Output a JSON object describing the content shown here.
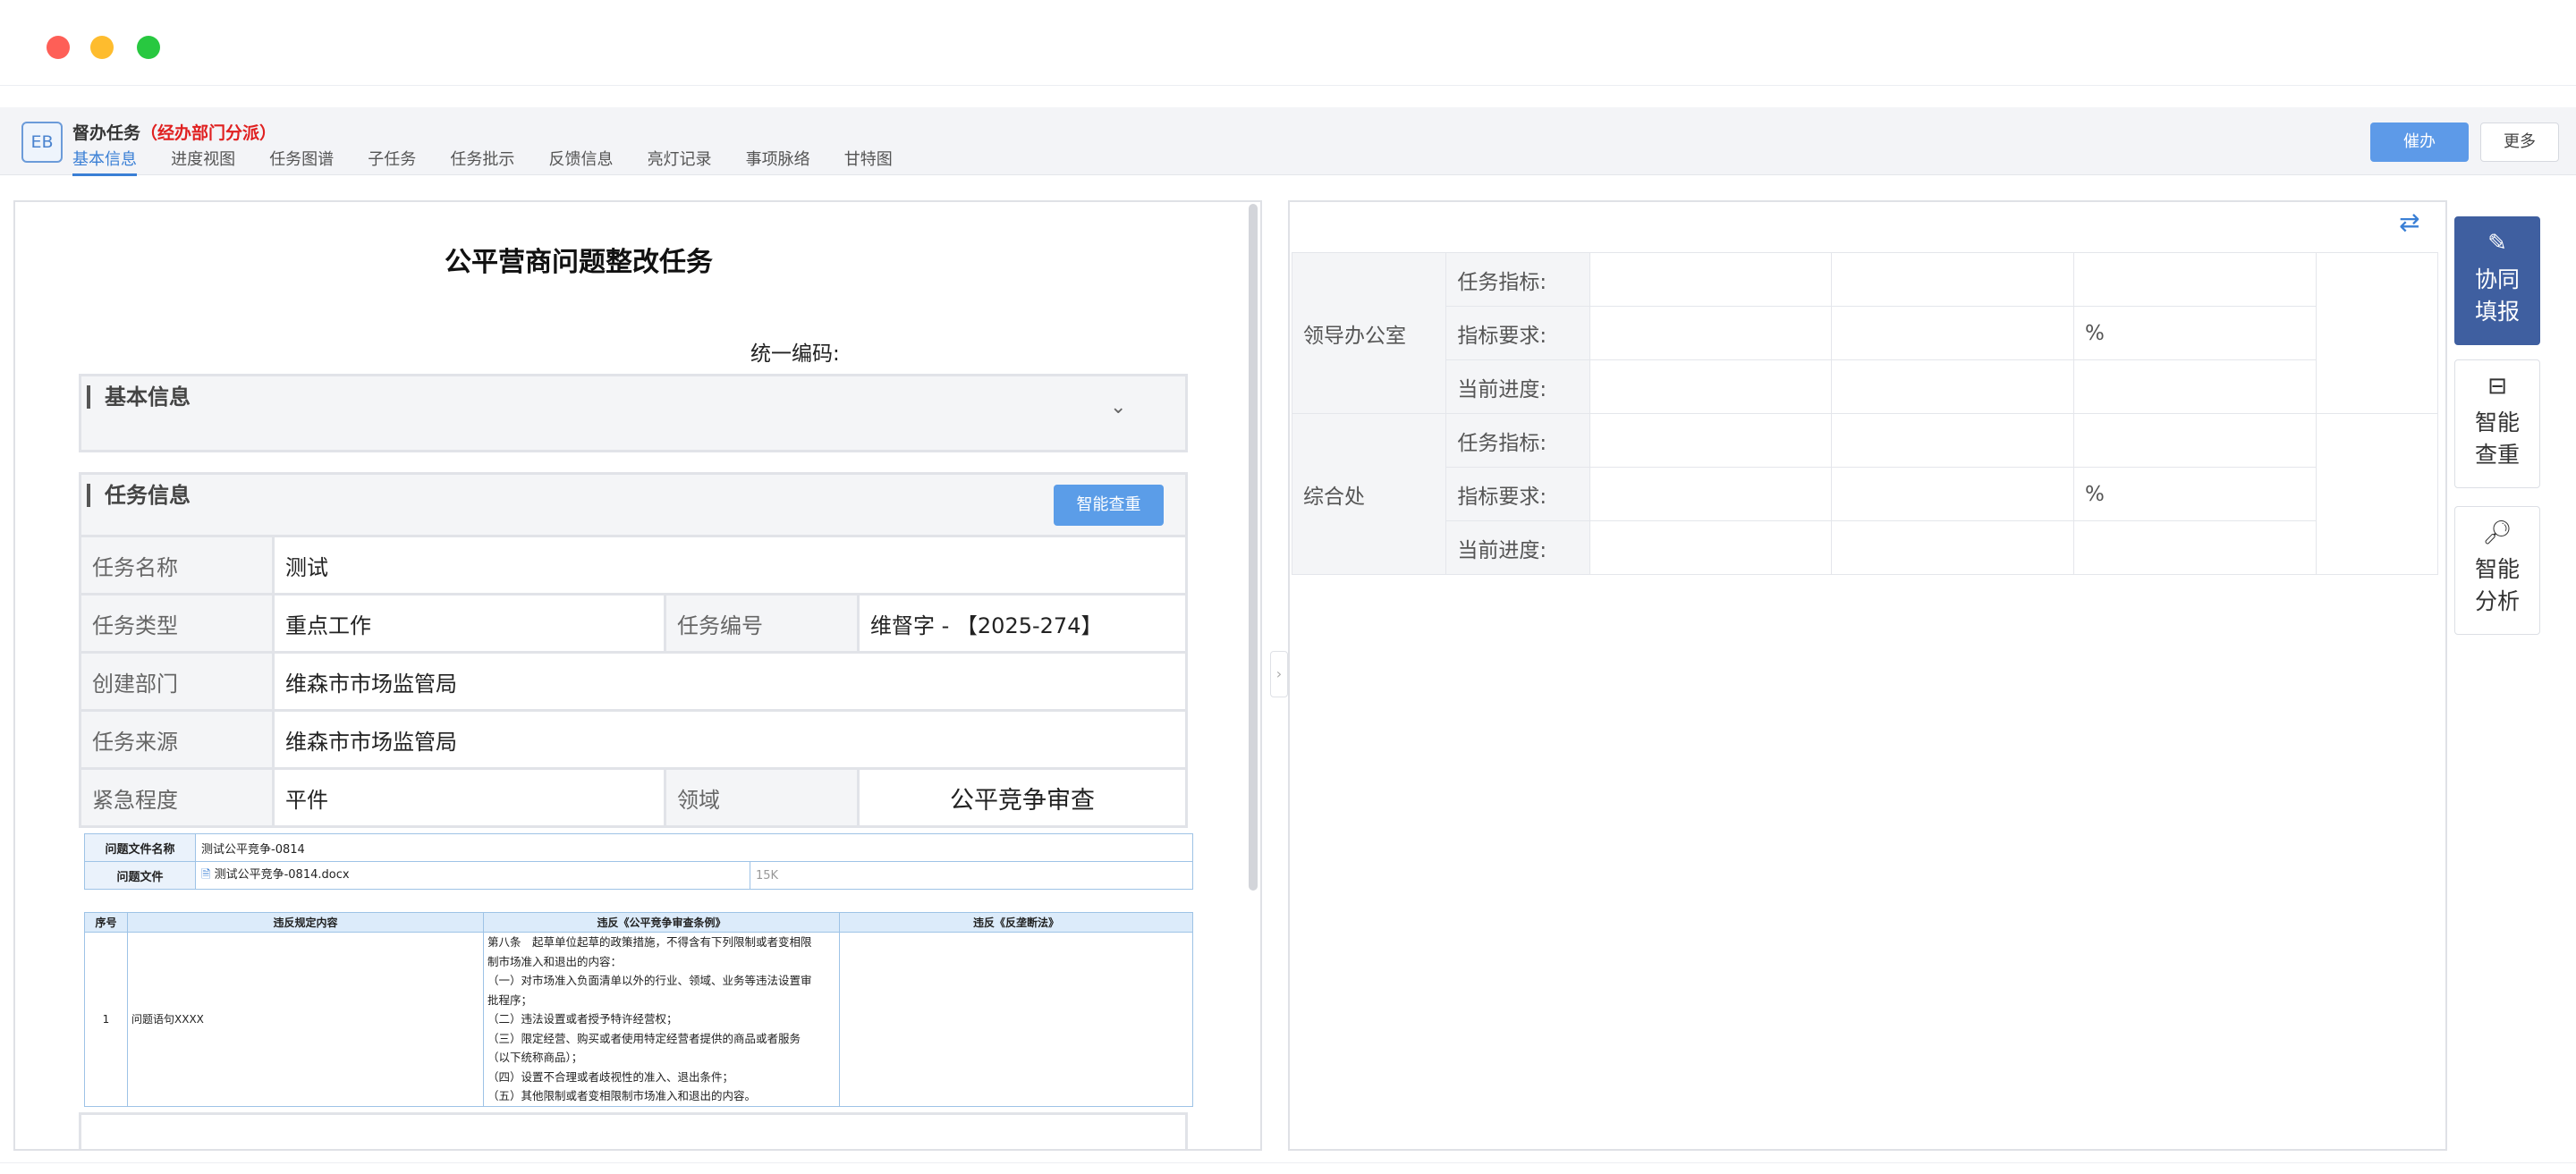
{
  "app": {
    "logo_text": "EB",
    "title": "督办任务",
    "title_tag": "（经办部门分派）",
    "tabs": [
      "基本信息",
      "进度视图",
      "任务图谱",
      "子任务",
      "任务批示",
      "反馈信息",
      "亮灯记录",
      "事项脉络",
      "甘特图"
    ],
    "active_tab": "基本信息",
    "urge_button": "催办",
    "more_button": "更多"
  },
  "doc": {
    "title": "公平营商问题整改任务",
    "code_label": "统一编码:",
    "basic_section": "基本信息",
    "task_section": "任务信息",
    "smart_check_button": "智能查重",
    "fields": {
      "task_name_label": "任务名称",
      "task_name": "测试",
      "task_type_label": "任务类型",
      "task_type": "重点工作",
      "task_no_label": "任务编号",
      "task_no": "维督字 - 【2025-274】",
      "dept_label": "创建部门",
      "dept": "维森市市场监管局",
      "source_label": "任务来源",
      "source": "维森市市场监管局",
      "urgency_label": "紧急程度",
      "urgency": "平件",
      "domain_label": "领域",
      "domain": "公平竞争审查"
    },
    "files": {
      "name_label": "问题文件名称",
      "name": "测试公平竞争-0814",
      "file_label": "问题文件",
      "file": "测试公平竞争-0814.docx",
      "size": "15K"
    },
    "violations": {
      "headers": [
        "序号",
        "违反规定内容",
        "违反《公平竞争审查条例》",
        "违反《反垄断法》"
      ],
      "row": {
        "index": "1",
        "content": "问题语句XXXX",
        "law_lines": [
          "第八条　起草单位起草的政策措施，不得含有下列限制或者变相限",
          "制市场准入和退出的内容：",
          "（一）对市场准入负面清单以外的行业、领域、业务等违法设置审",
          "批程序；",
          "（二）违法设置或者授予特许经营权；",
          "（三）限定经营、购买或者使用特定经营者提供的商品或者服务",
          "（以下统称商品）；",
          "（四）设置不合理或者歧视性的准入、退出条件；",
          "（五）其他限制或者变相限制市场准入和退出的内容。"
        ],
        "antitrust": ""
      }
    }
  },
  "indicators": {
    "groups": [
      {
        "dept": "领导办公室",
        "rows": [
          {
            "label": "任务指标:",
            "unit": ""
          },
          {
            "label": "指标要求:",
            "unit": "%"
          },
          {
            "label": "当前进度:",
            "unit": ""
          }
        ]
      },
      {
        "dept": "综合处",
        "rows": [
          {
            "label": "任务指标:",
            "unit": ""
          },
          {
            "label": "指标要求:",
            "unit": "%"
          },
          {
            "label": "当前进度:",
            "unit": ""
          }
        ]
      }
    ]
  },
  "sidebar": {
    "buttons": [
      {
        "label": "协同填报",
        "icon": "edit-icon"
      },
      {
        "label": "智能查重",
        "icon": "filter-icon"
      },
      {
        "label": "智能分析",
        "icon": "doc-search-icon"
      }
    ]
  }
}
